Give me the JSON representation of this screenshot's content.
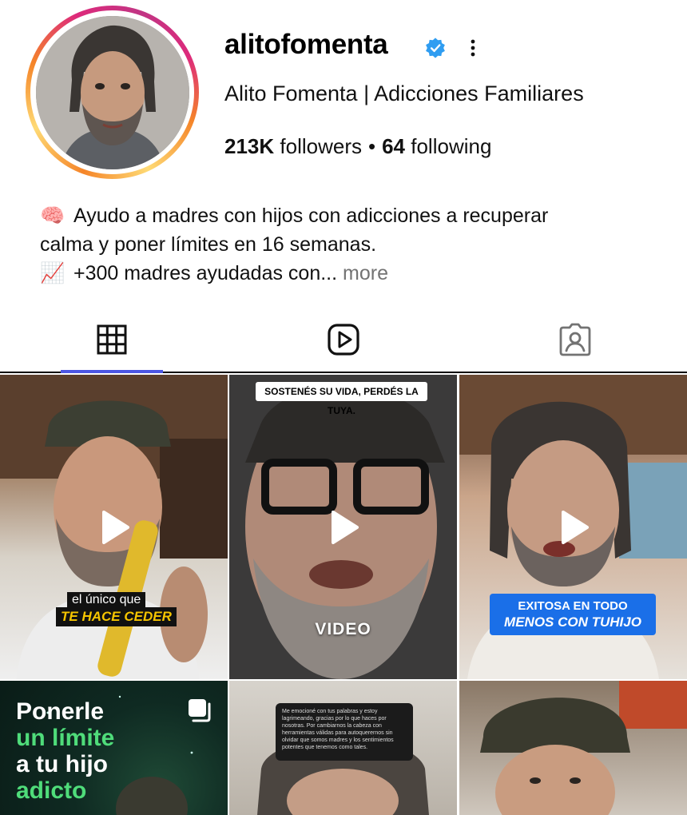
{
  "profile": {
    "username": "alitofomenta",
    "verified": true,
    "full_name": "Alito Fomenta | Adicciones Familiares",
    "followers_count": "213K",
    "followers_label": "followers",
    "separator": "•",
    "following_count": "64",
    "following_label": "following",
    "ring_colors": [
      "#feda75",
      "#f58529",
      "#dd2a7b",
      "#c13584"
    ],
    "verified_color": "#2f9df1"
  },
  "bio": {
    "line1_emoji": "🧠",
    "line1_text": "Ayudo a madres con hijos con adicciones a recuperar",
    "line2_text": "calma y poner límites en 16 semanas.",
    "line3_emoji": "📈",
    "line3_text": "+300 madres ayudadas con...",
    "more_label": "more"
  },
  "tabs": [
    {
      "icon": "grid-icon",
      "active": true
    },
    {
      "icon": "reels-icon",
      "active": false
    },
    {
      "icon": "tagged-icon",
      "active": false
    }
  ],
  "accent_color": "#4b56e3",
  "posts": [
    {
      "type": "reel",
      "caption_line1": "el único que",
      "caption_line2": "TE HACE CEDER"
    },
    {
      "type": "reel",
      "top_sticker": "SOSTENÉS SU VIDA, PERDÉS LA TUYA.",
      "center_word": "VIDEO"
    },
    {
      "type": "reel",
      "caption_line1": "EXITOSA EN TODO",
      "caption_line2": "MENOS CON TUHIJO"
    },
    {
      "type": "carousel",
      "line1": "Ponerle",
      "line2": "un límite",
      "line3": "a tu hijo",
      "line4": "adicto"
    },
    {
      "type": "image",
      "chat_text": "Me emocioné con tus palabras y estoy lagrimeando, gracias por lo que haces por nosotras. Por cambiarnos la cabeza con herramientas válidas para autoquerernos sin olvidar que somos madres y los sentimientos potentes que tenemos como tales."
    },
    {
      "type": "reel"
    }
  ]
}
